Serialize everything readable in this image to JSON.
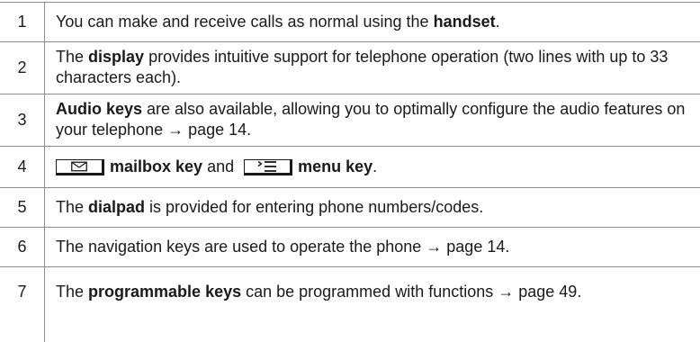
{
  "rows": [
    {
      "number": "1",
      "pre": "You can make and receive calls as normal using the ",
      "bold": "handset",
      "post": "."
    },
    {
      "number": "2",
      "pre": "The ",
      "bold": "display",
      "post": " provides intuitive support for telephone operation (two lines with up to 33 characters each)."
    },
    {
      "number": "3",
      "bold": "Audio keys",
      "post": " are also available, allowing you to optimally configure the audio features on your telephone → page 14."
    },
    {
      "number": "4",
      "bold_a": "mailbox key",
      "mid": " and ",
      "bold_b": "menu key",
      "post": "."
    },
    {
      "number": "5",
      "pre": "The ",
      "bold": "dialpad",
      "post": " is provided for entering phone numbers/codes."
    },
    {
      "number": "6",
      "text": "The navigation keys are used to operate the phone → page 14."
    },
    {
      "number": "7",
      "pre": "The ",
      "bold": "programmable keys",
      "post": " can be programmed with functions → page 49."
    }
  ]
}
